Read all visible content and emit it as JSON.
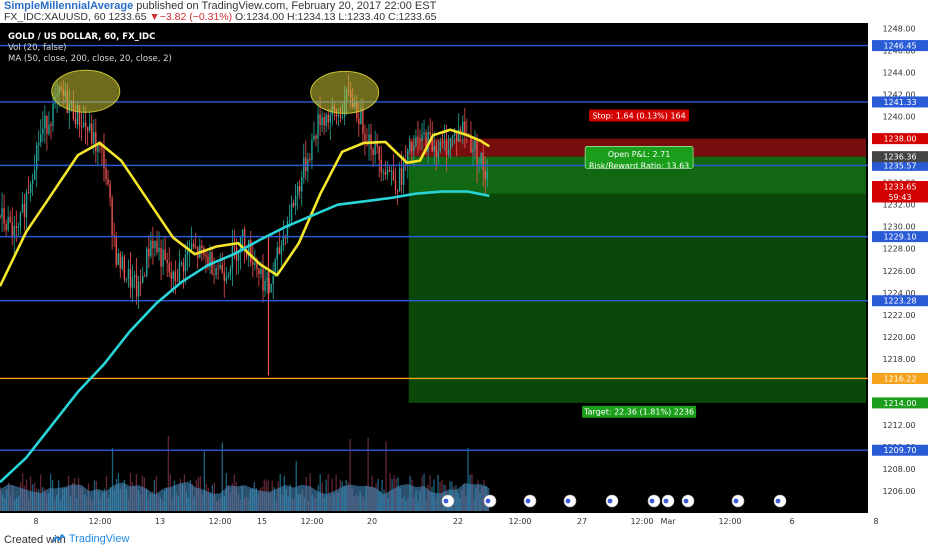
{
  "header": {
    "author": "SimpleMillennialAverage",
    "published": "published on TradingView.com, February 20, 2017 22:00 EST",
    "symbol": "FX_IDC:XAUUSD, 60",
    "last": "1233.65",
    "change": "▼−3.82 (−0.31%)",
    "ohlc": "O:1234.00 H:1234.13 L:1233.40 C:1233.65"
  },
  "legend": {
    "title": "GOLD / US DOLLAR, 60, FX_IDC",
    "vol": "Vol (20, false)",
    "ma": "MA (50, close, 200, close, 20, close, 2)"
  },
  "footer": {
    "created_with": "Created with",
    "brand": "TradingView",
    "brand_icon": "tradingview-logo-icon"
  },
  "colors": {
    "background": "#000000",
    "support_line": "#2a5bd7",
    "orange_line": "#f7a21b",
    "ma50": "#f5e52b",
    "ma200": "#29d4d8",
    "stop_zone": "#8c0f0f",
    "target_zone": "#0b5a0b",
    "ellipse": "#c8c234",
    "candle_up": "#26a69a",
    "candle_down": "#ef5350"
  },
  "chart_data": {
    "type": "candlestick",
    "title": "GOLD / US DOLLAR, 60, FX_IDC",
    "ylim": [
      1204.0,
      1248.5
    ],
    "y_ticks": [
      1206,
      1208,
      1210,
      1212,
      1214,
      1216,
      1218,
      1220,
      1222,
      1224,
      1226,
      1228,
      1230,
      1232,
      1234,
      1236,
      1238,
      1240,
      1242,
      1244,
      1246,
      1248
    ],
    "x_ticks": [
      "8",
      "12:00",
      "13",
      "12:00",
      "15",
      "12:00",
      "20",
      "22",
      "12:00",
      "27",
      "12:00",
      "Mar",
      "12:00",
      "6",
      "8"
    ],
    "x_tick_positions": [
      0.036,
      0.115,
      0.188,
      0.262,
      0.333,
      0.405,
      0.481,
      0.596,
      0.678,
      0.759,
      0.838,
      0.918,
      0.99,
      1.0,
      1.0
    ],
    "horizontal_levels": [
      {
        "value": 1246.45,
        "label": "1246.45",
        "color": "blue"
      },
      {
        "value": 1241.33,
        "label": "1241.33",
        "color": "blue"
      },
      {
        "value": 1235.57,
        "label": "1235.57",
        "color": "blue"
      },
      {
        "value": 1229.1,
        "label": "1229.10",
        "color": "blue"
      },
      {
        "value": 1223.28,
        "label": "1223.28",
        "color": "blue"
      },
      {
        "value": 1216.22,
        "label": "1216.22",
        "color": "orange"
      },
      {
        "value": 1209.7,
        "label": "1209.70",
        "color": "blue"
      }
    ],
    "price_labels": [
      {
        "value": 1238.0,
        "label": "1238.00",
        "kind": "stop"
      },
      {
        "value": 1236.36,
        "label": "1236.36",
        "kind": "entry"
      },
      {
        "value": 1233.65,
        "label": "1233.65",
        "kind": "last"
      },
      {
        "value": 1232.7,
        "label": "59:43",
        "kind": "countdown"
      },
      {
        "value": 1214.0,
        "label": "1214.00",
        "kind": "target"
      }
    ],
    "position": {
      "entry": 1236.36,
      "stop": 1238.0,
      "target": 1214.0,
      "stop_label": "Stop: 1.64 (0.13%) 164",
      "pnl_label": "Open P&L: 2.71",
      "rr_label": "Risk/Reward Ratio: 13.63",
      "target_label": "Target: 22.36 (1.81%) 2236"
    },
    "series": [
      {
        "name": "MA 50",
        "points": [
          [
            0.0,
            1224.6
          ],
          [
            0.03,
            1229.5
          ],
          [
            0.06,
            1233.0
          ],
          [
            0.09,
            1236.5
          ],
          [
            0.115,
            1237.6
          ],
          [
            0.14,
            1236.0
          ],
          [
            0.17,
            1232.5
          ],
          [
            0.2,
            1229.0
          ],
          [
            0.225,
            1227.5
          ],
          [
            0.25,
            1228.2
          ],
          [
            0.275,
            1228.5
          ],
          [
            0.3,
            1226.6
          ],
          [
            0.32,
            1225.6
          ],
          [
            0.345,
            1228.5
          ],
          [
            0.37,
            1233.0
          ],
          [
            0.395,
            1236.8
          ],
          [
            0.42,
            1237.6
          ],
          [
            0.445,
            1237.7
          ],
          [
            0.47,
            1235.8
          ],
          [
            0.485,
            1236.0
          ],
          [
            0.5,
            1238.3
          ],
          [
            0.52,
            1238.8
          ],
          [
            0.54,
            1238.3
          ],
          [
            0.555,
            1237.8
          ],
          [
            0.565,
            1237.3
          ]
        ]
      },
      {
        "name": "MA 200",
        "points": [
          [
            0.0,
            1206.8
          ],
          [
            0.03,
            1209.0
          ],
          [
            0.06,
            1212.0
          ],
          [
            0.09,
            1215.0
          ],
          [
            0.12,
            1217.5
          ],
          [
            0.15,
            1220.5
          ],
          [
            0.18,
            1223.0
          ],
          [
            0.21,
            1225.0
          ],
          [
            0.24,
            1226.5
          ],
          [
            0.27,
            1227.5
          ],
          [
            0.3,
            1228.8
          ],
          [
            0.33,
            1230.0
          ],
          [
            0.36,
            1231.0
          ],
          [
            0.39,
            1232.0
          ],
          [
            0.42,
            1232.3
          ],
          [
            0.45,
            1232.6
          ],
          [
            0.48,
            1233.0
          ],
          [
            0.51,
            1233.2
          ],
          [
            0.54,
            1233.2
          ],
          [
            0.565,
            1232.8
          ]
        ]
      }
    ],
    "highlight_ellipses": [
      {
        "x": 0.099,
        "value": 1242.3
      },
      {
        "x": 0.398,
        "value": 1242.2
      }
    ]
  }
}
